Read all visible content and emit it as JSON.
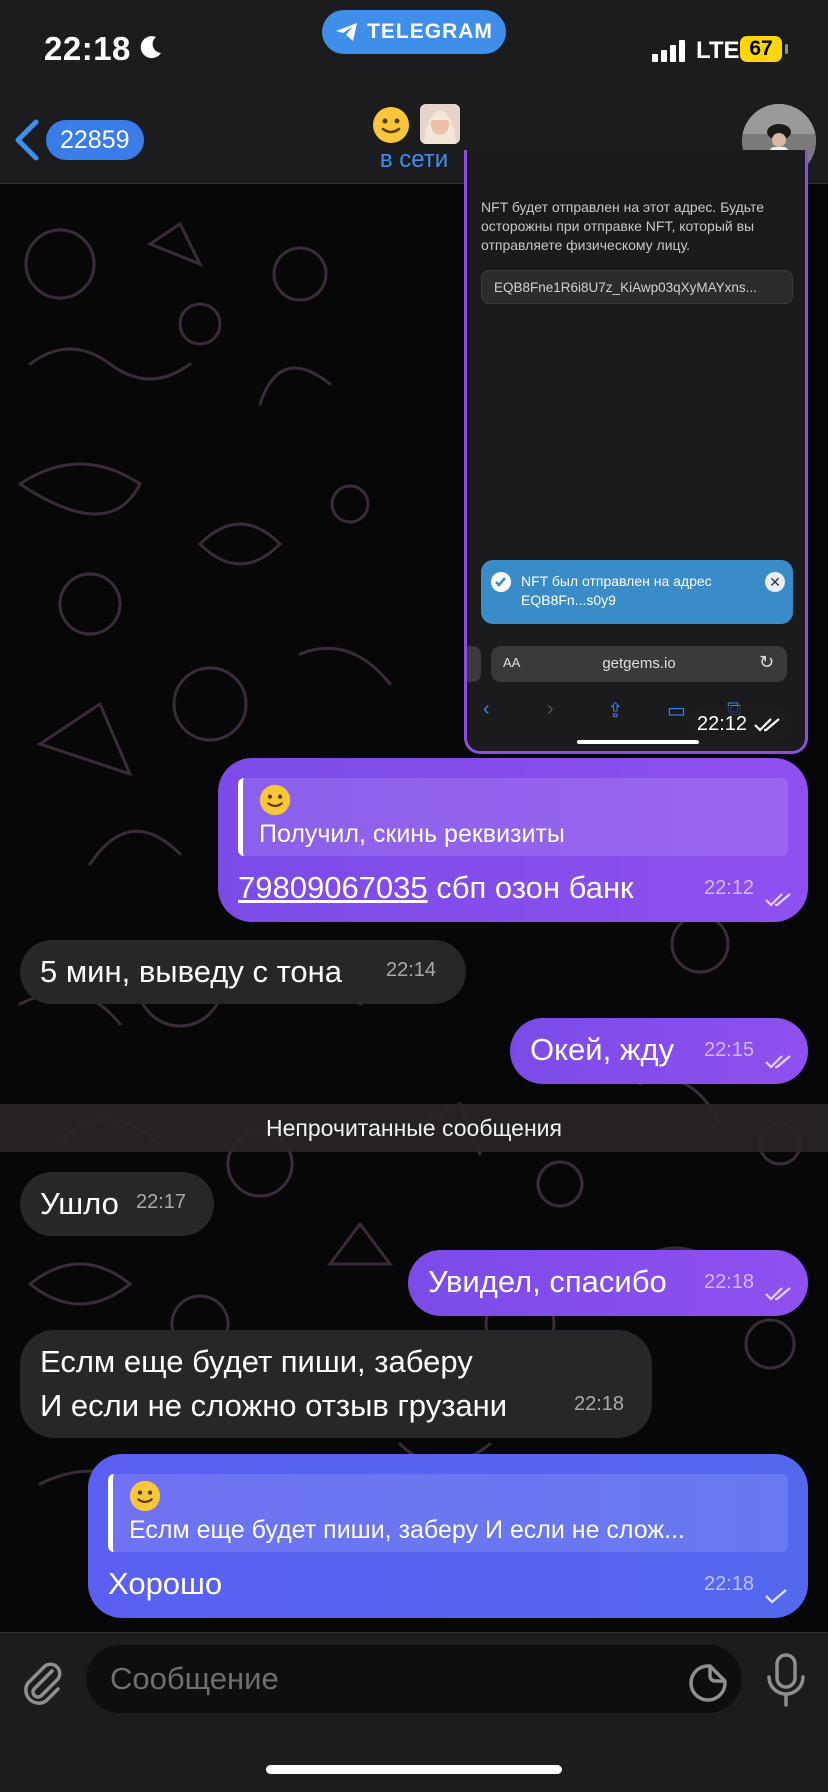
{
  "status_bar": {
    "time": "22:18",
    "carrier_pill": "TELEGRAM",
    "network": "LTE",
    "battery": "67"
  },
  "header": {
    "back_count": "22859",
    "status": "в сети"
  },
  "image_message": {
    "nft_text": "NFT будет отправлен на этот адрес. Будьте осторожны при отправке NFT, который вы отправляете физическому лицу.",
    "address": "EQB8Fne1R6i8U7z_KiAwp03qXyMAYxns...",
    "toast": "NFT был отправлен на адрес EQB8Fn...s0y9",
    "url_aa": "AA",
    "url": "getgems.io",
    "time": "22:12"
  },
  "messages": [
    {
      "id": "m1",
      "direction": "out",
      "reply_text": "Получил, скинь реквизиты",
      "phone": "79809067035",
      "text": " сбп озон банк",
      "time": "22:12"
    },
    {
      "id": "m2",
      "direction": "in",
      "text": "5 мин, выведу с тона",
      "time": "22:14"
    },
    {
      "id": "m3",
      "direction": "out",
      "text": "Окей, жду",
      "time": "22:15"
    },
    {
      "id": "m4",
      "direction": "in",
      "text": "Ушло",
      "time": "22:17"
    },
    {
      "id": "m5",
      "direction": "out",
      "text": "Увидел, спасибо",
      "time": "22:18"
    },
    {
      "id": "m6",
      "direction": "in",
      "line1": "Еслм еще будет пиши, заберу",
      "line2": "И если не сложно отзыв грузани",
      "time": "22:18"
    },
    {
      "id": "m7",
      "direction": "out",
      "reply_text": "Еслм еще будет пиши, заберу И если не слож...",
      "text": "Хорошо",
      "time": "22:18"
    }
  ],
  "unread_divider": "Непрочитанные сообщения",
  "input": {
    "placeholder": "Сообщение"
  },
  "colors": {
    "accent": "#3a8fef",
    "outgoing_bubble": "#8a4fec",
    "incoming_bubble": "#272629",
    "last_bubble": "#5b63f0"
  }
}
